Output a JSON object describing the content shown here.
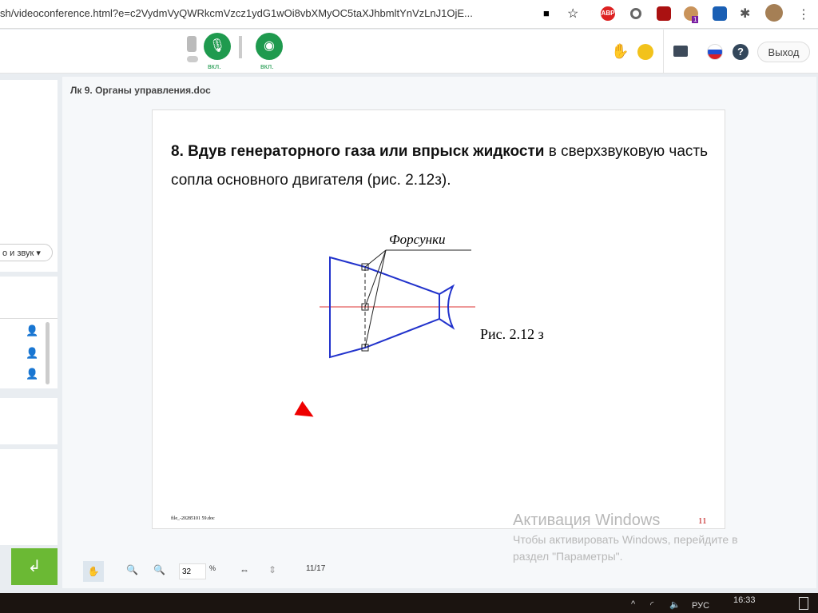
{
  "browser": {
    "url": "sh/videoconference.html?e=c2VydmVyQWRkcmVzcz1ydG1wOi8vbXMyOC5taXJhbmltYnVzLnJ1OjE...",
    "ext_badge": "1",
    "abp": "ABP"
  },
  "header": {
    "mic_label": "вкл.",
    "cam_label": "вкл.",
    "exit_label": "Выход"
  },
  "left": {
    "dropdown_label": "о и звук"
  },
  "document": {
    "title": "Лк 9. Органы управления.doc",
    "heading_bold": "8. Вдув генераторного газа или впрыск жидкости",
    "heading_rest": " в сверхзвуковую часть сопла основного двигателя (рис. 2.12з).",
    "figure_label": "Форсунки",
    "figure_caption": "Рис. 2.12 з",
    "footer_file": "file_-20285101 59.doc",
    "page_number": "11"
  },
  "toolbar": {
    "zoom_value": "32",
    "zoom_unit": "%",
    "page_indicator": "11/17"
  },
  "watermark": {
    "title": "Активация Windows",
    "line1": "Чтобы активировать Windows, перейдите в",
    "line2": "раздел \"Параметры\"."
  },
  "taskbar": {
    "lang": "РУС",
    "time": "16:33"
  }
}
